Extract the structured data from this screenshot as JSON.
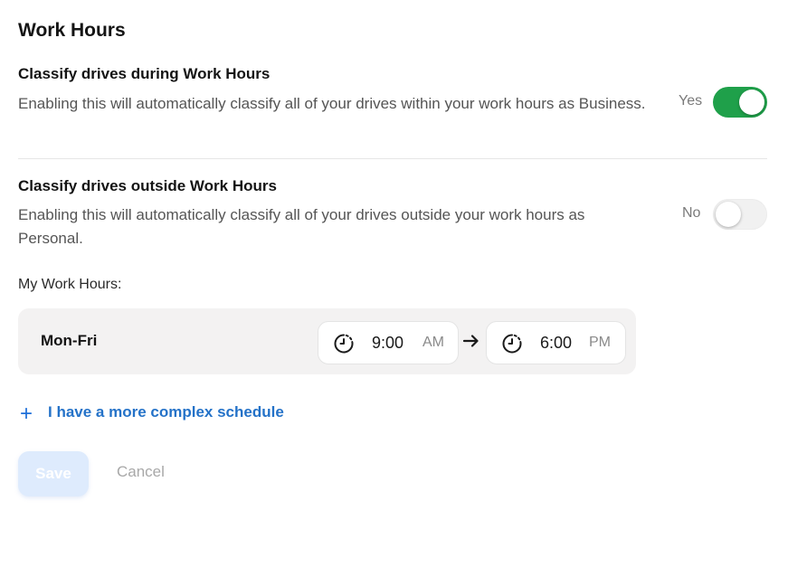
{
  "page": {
    "title": "Work Hours"
  },
  "during": {
    "title": "Classify drives during Work Hours",
    "description": "Enabling this will automatically classify all of your drives within your work hours as Business.",
    "state_label": "Yes",
    "enabled": true,
    "accent_color": "#1fa04a"
  },
  "outside": {
    "title": "Classify drives outside Work Hours",
    "description": "Enabling this will automatically classify all of your drives outside your work hours as Personal.",
    "state_label": "No",
    "enabled": false
  },
  "schedule": {
    "label": "My Work Hours:",
    "rows": [
      {
        "day": "Mon-Fri",
        "start": {
          "time": "9:00",
          "period": "AM"
        },
        "end": {
          "time": "6:00",
          "period": "PM"
        }
      }
    ],
    "icons": {
      "time": "clock-icon",
      "separator": "arrow-right-icon"
    }
  },
  "complex_schedule": {
    "icon": "plus-icon",
    "label": "I have a more complex schedule",
    "color": "#2472c8"
  },
  "actions": {
    "save_label": "Save",
    "cancel_label": "Cancel",
    "save_bg": "#deebfd"
  }
}
